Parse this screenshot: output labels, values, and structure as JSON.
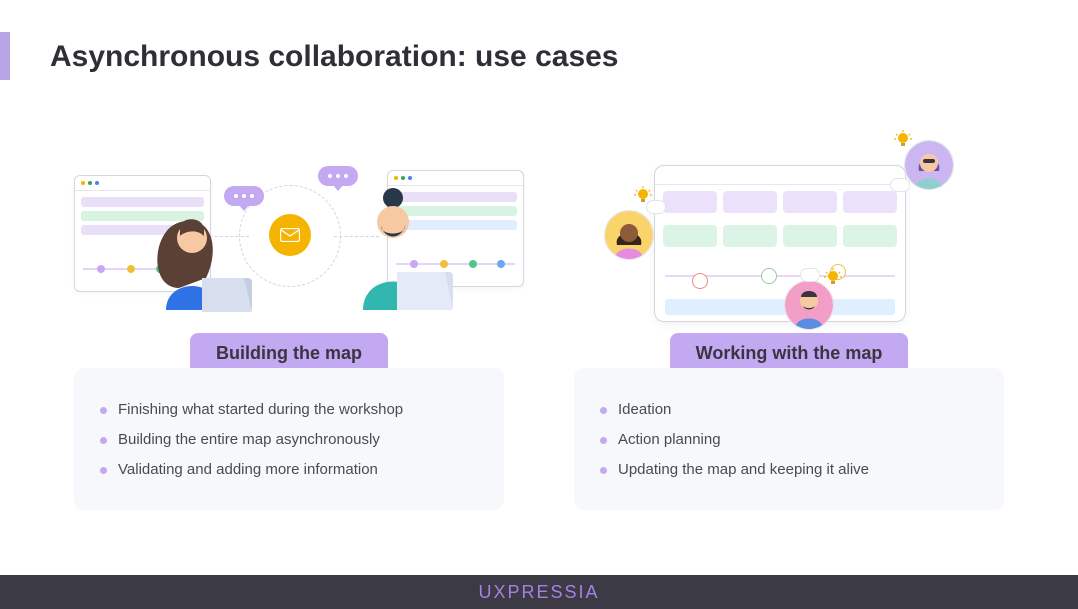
{
  "slide": {
    "title": "Asynchronous collaboration: use cases"
  },
  "columns": [
    {
      "heading": "Building the map",
      "items": [
        "Finishing what started during the workshop",
        "Building the entire map asynchronously",
        "Validating and adding more information"
      ]
    },
    {
      "heading": "Working with the map",
      "items": [
        "Ideation",
        "Action planning",
        "Updating the map and keeping it alive"
      ]
    }
  ],
  "footer": {
    "brand": "UXPRESSIA"
  }
}
